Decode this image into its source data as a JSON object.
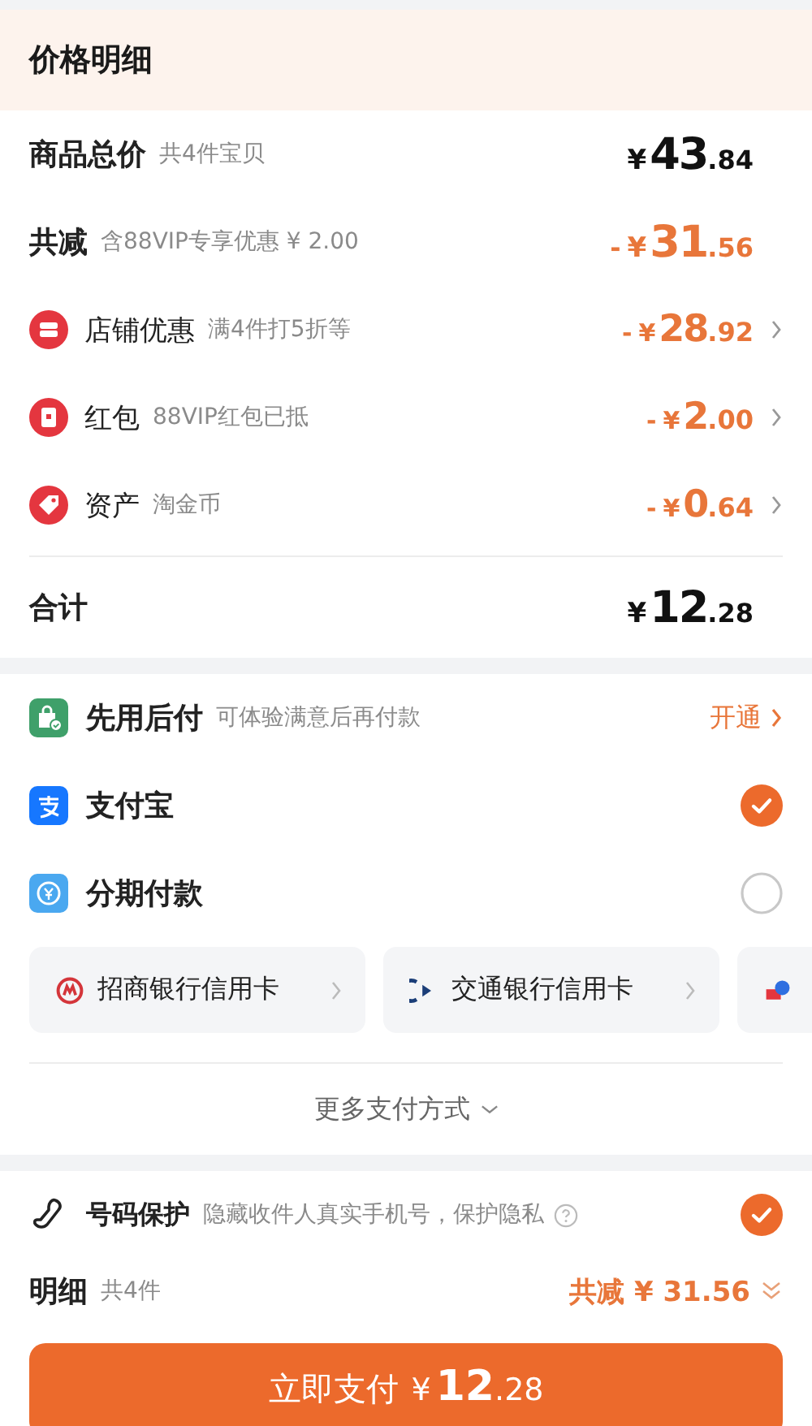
{
  "header": {
    "title": "价格明细"
  },
  "summary_rows": [
    {
      "kind": "plain",
      "label": "商品总价",
      "note": "共4件宝贝",
      "amount": {
        "yen": "¥",
        "int": "43",
        "dec": ".84"
      },
      "discount": false,
      "chevron": false
    },
    {
      "kind": "plain",
      "label": "共减",
      "note": "含88VIP专享优惠 ¥ 2.00",
      "amount": {
        "sign": "-",
        "yen": "¥",
        "int": "31",
        "dec": ".56"
      },
      "discount": true,
      "chevron": false
    },
    {
      "kind": "shop",
      "label": "店铺优惠",
      "note": "满4件打5折等",
      "amount": {
        "sign": "-",
        "yen": "¥",
        "int": "28",
        "dec": ".92"
      },
      "discount": true,
      "chevron": true
    },
    {
      "kind": "redpacket",
      "label": "红包",
      "note": "88VIP红包已抵",
      "amount": {
        "sign": "-",
        "yen": "¥",
        "int": "2",
        "dec": ".00"
      },
      "discount": true,
      "chevron": true
    },
    {
      "kind": "asset",
      "label": "资产",
      "note": "淘金币",
      "amount": {
        "sign": "-",
        "yen": "¥",
        "int": "0",
        "dec": ".64"
      },
      "discount": true,
      "chevron": true
    }
  ],
  "total": {
    "label": "合计",
    "amount": {
      "yen": "¥",
      "int": "12",
      "dec": ".28"
    }
  },
  "payment_methods": [
    {
      "kind": "paylater",
      "label": "先用后付",
      "note": "可体验满意后再付款",
      "action": "开通"
    },
    {
      "kind": "alipay",
      "label": "支付宝",
      "selected": true
    },
    {
      "kind": "installment",
      "label": "分期付款",
      "selected": false
    }
  ],
  "bank_cards": [
    {
      "kind": "cmb",
      "label": "招商银行信用卡"
    },
    {
      "kind": "bocom",
      "label": "交通银行信用卡"
    },
    {
      "kind": "other"
    }
  ],
  "more_payment": "更多支付方式",
  "number_protection": {
    "label": "号码保护",
    "note": "隐藏收件人真实手机号，保护隐私",
    "checked": true
  },
  "detail": {
    "label": "明细",
    "count": "共4件",
    "saving": "共减 ¥ 31.56"
  },
  "pay_button": {
    "label": "立即支付",
    "amount": {
      "yen": "¥",
      "int": "12",
      "dec": ".28"
    }
  }
}
